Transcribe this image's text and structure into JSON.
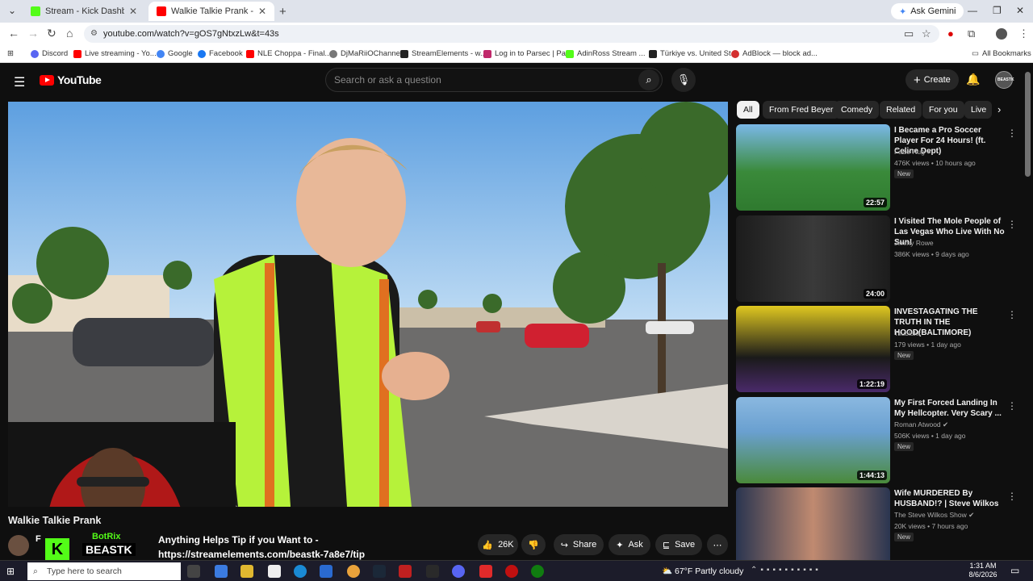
{
  "browser": {
    "tabs": [
      {
        "title": "Stream - Kick Dashboard",
        "favicon_color": "#53fc18"
      },
      {
        "title": "Walkie Talkie Prank - YouTube",
        "favicon_color": "#ff0000"
      }
    ],
    "new_tab": "+",
    "gemini": "Ask Gemini",
    "url": "youtube.com/watch?v=gOS7gNtxzLw&t=43s",
    "bookmarks": [
      {
        "label": "Discord",
        "color": "#5865f2"
      },
      {
        "label": "Live streaming - Yo...",
        "color": "#ff0000"
      },
      {
        "label": "Google",
        "color": "#4285f4"
      },
      {
        "label": "Facebook",
        "color": "#1877f2"
      },
      {
        "label": "NLE Choppa - Final...",
        "color": "#ff0000"
      },
      {
        "label": "DjMaRiiOChannel",
        "color": "#777777"
      },
      {
        "label": "StreamElements - w...",
        "color": "#222222"
      },
      {
        "label": "Log in to Parsec | Pa...",
        "color": "#c0286a"
      },
      {
        "label": "AdinRoss Stream ...",
        "color": "#53fc18"
      },
      {
        "label": "Türkiye vs. United St...",
        "color": "#222222"
      },
      {
        "label": "AdBlock — block ad...",
        "color": "#d32f2f"
      }
    ],
    "all_bookmarks": "All Bookmarks"
  },
  "yt": {
    "logo_text": "YouTube",
    "search_placeholder": "Search or ask a question",
    "create_label": "Create",
    "avatar_text": "BEASTK",
    "video_title": "Walkie Talkie Prank",
    "channel_short": "F",
    "overlay": {
      "bot_name": "BotRix",
      "streamer": "BEASTK",
      "letter": "K"
    },
    "tip_line1": "Anything Helps Tip if you Want to -",
    "tip_line2": "https://streamelements.com/beastk-7a8e7/tip",
    "like_count": "26K",
    "share_label": "Share",
    "ask_label": "Ask",
    "save_label": "Save",
    "chips": [
      "All",
      "From Fred Beyer",
      "Comedy",
      "Related",
      "For you",
      "Live"
    ],
    "recs": [
      {
        "title": "I Became a Pro Soccer Player For 24 Hours! (ft. Celine Dept)",
        "channel": "FaZe Rug",
        "meta": "476K views • 10 hours ago",
        "badge": "New",
        "duration": "22:57",
        "bg": "#3a8a3a"
      },
      {
        "title": "I Visited The Mole People of Las Vegas Who Live With No Sun!",
        "channel": "Jimmy Rowe",
        "meta": "386K views • 9 days ago",
        "badge": "",
        "duration": "24:00",
        "bg": "#2a2a2a"
      },
      {
        "title": "INVESTAGATING THE TRUTH IN THE HOOD(BALTIMORE)",
        "channel": "Tsublakk",
        "meta": "179 views • 1 day ago",
        "badge": "New",
        "duration": "1:22:19",
        "bg": "#d8c020"
      },
      {
        "title": "My First Forced Landing In My Hellcopter. Very Scary ...",
        "channel": "Roman Atwood",
        "meta": "506K views • 1 day ago",
        "badge": "New",
        "duration": "1:44:13",
        "bg": "#6aa0d0"
      },
      {
        "title": "Wife MURDERED By HUSBAND!? | Steve Wilkos",
        "channel": "The Steve Wilkos Show",
        "meta": "20K views • 7 hours ago",
        "badge": "New",
        "duration": "",
        "bg": "#2a3550"
      }
    ]
  },
  "taskbar": {
    "search_placeholder": "Type here to search",
    "weather": "67°F  Partly cloudy",
    "time": "1:31 AM",
    "date": "8/6/2026"
  }
}
